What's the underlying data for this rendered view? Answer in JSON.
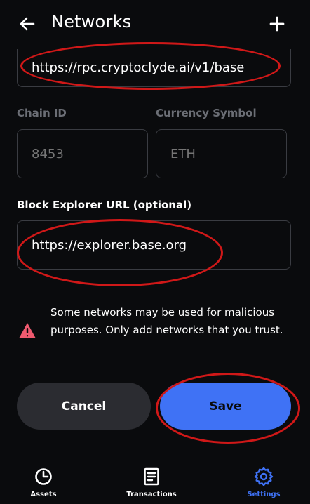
{
  "header": {
    "title": "Networks",
    "back_icon": "arrow-left-icon",
    "add_icon": "plus-icon"
  },
  "form": {
    "rpc_url_value": "https://rpc.cryptoclyde.ai/v1/base",
    "chain_id_label": "Chain ID",
    "chain_id_placeholder": "8453",
    "currency_symbol_label": "Currency Symbol",
    "currency_symbol_placeholder": "ETH",
    "explorer_label": "Block Explorer URL (optional)",
    "explorer_value": "https://explorer.base.org"
  },
  "warning": {
    "icon": "warning-triangle-icon",
    "text": "Some networks may be used for malicious purposes. Only add networks that you trust."
  },
  "actions": {
    "cancel_label": "Cancel",
    "save_label": "Save"
  },
  "nav": {
    "items": [
      {
        "label": "Assets",
        "icon": "pie-chart-icon",
        "active": false
      },
      {
        "label": "Transactions",
        "icon": "document-icon",
        "active": false
      },
      {
        "label": "Settings",
        "icon": "gear-icon",
        "active": true
      }
    ]
  },
  "colors": {
    "background": "#0a0b0d",
    "accent": "#3f72f5",
    "annotation": "#d01818",
    "warning": "#ef5a6f",
    "muted": "#6b6e75"
  }
}
